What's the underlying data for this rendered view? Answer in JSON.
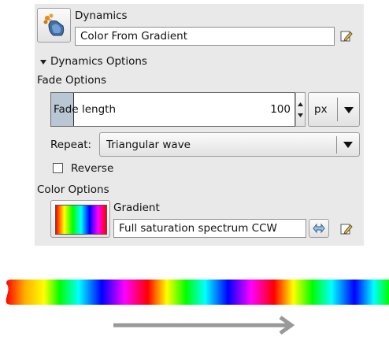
{
  "dynamics": {
    "label": "Dynamics",
    "value": "Color From Gradient"
  },
  "dynamics_options": {
    "expander_label": "Dynamics Options",
    "expanded": true
  },
  "fade_options": {
    "section_label": "Fade Options",
    "fade_length_label": "Fade length",
    "fade_length_value": "100",
    "unit": "px",
    "repeat_label": "Repeat:",
    "repeat_value": "Triangular wave",
    "reverse_label": "Reverse",
    "reverse_checked": false
  },
  "color_options": {
    "section_label": "Color Options",
    "gradient_label": "Gradient",
    "gradient_value": "Full saturation spectrum CCW"
  },
  "colors": {
    "panel_bg": "#e9e9e9",
    "slider_fill": "#b9c6d3",
    "arrow_gray": "#999999"
  },
  "icons": {
    "dynamics": "dynamics-brush-icon",
    "edit": "edit-pencil-icon",
    "swap": "swap-arrows-icon",
    "spin": "spin-arrows-icon",
    "dropdown": "dropdown-arrow-icon",
    "direction": "right-arrow-icon"
  }
}
